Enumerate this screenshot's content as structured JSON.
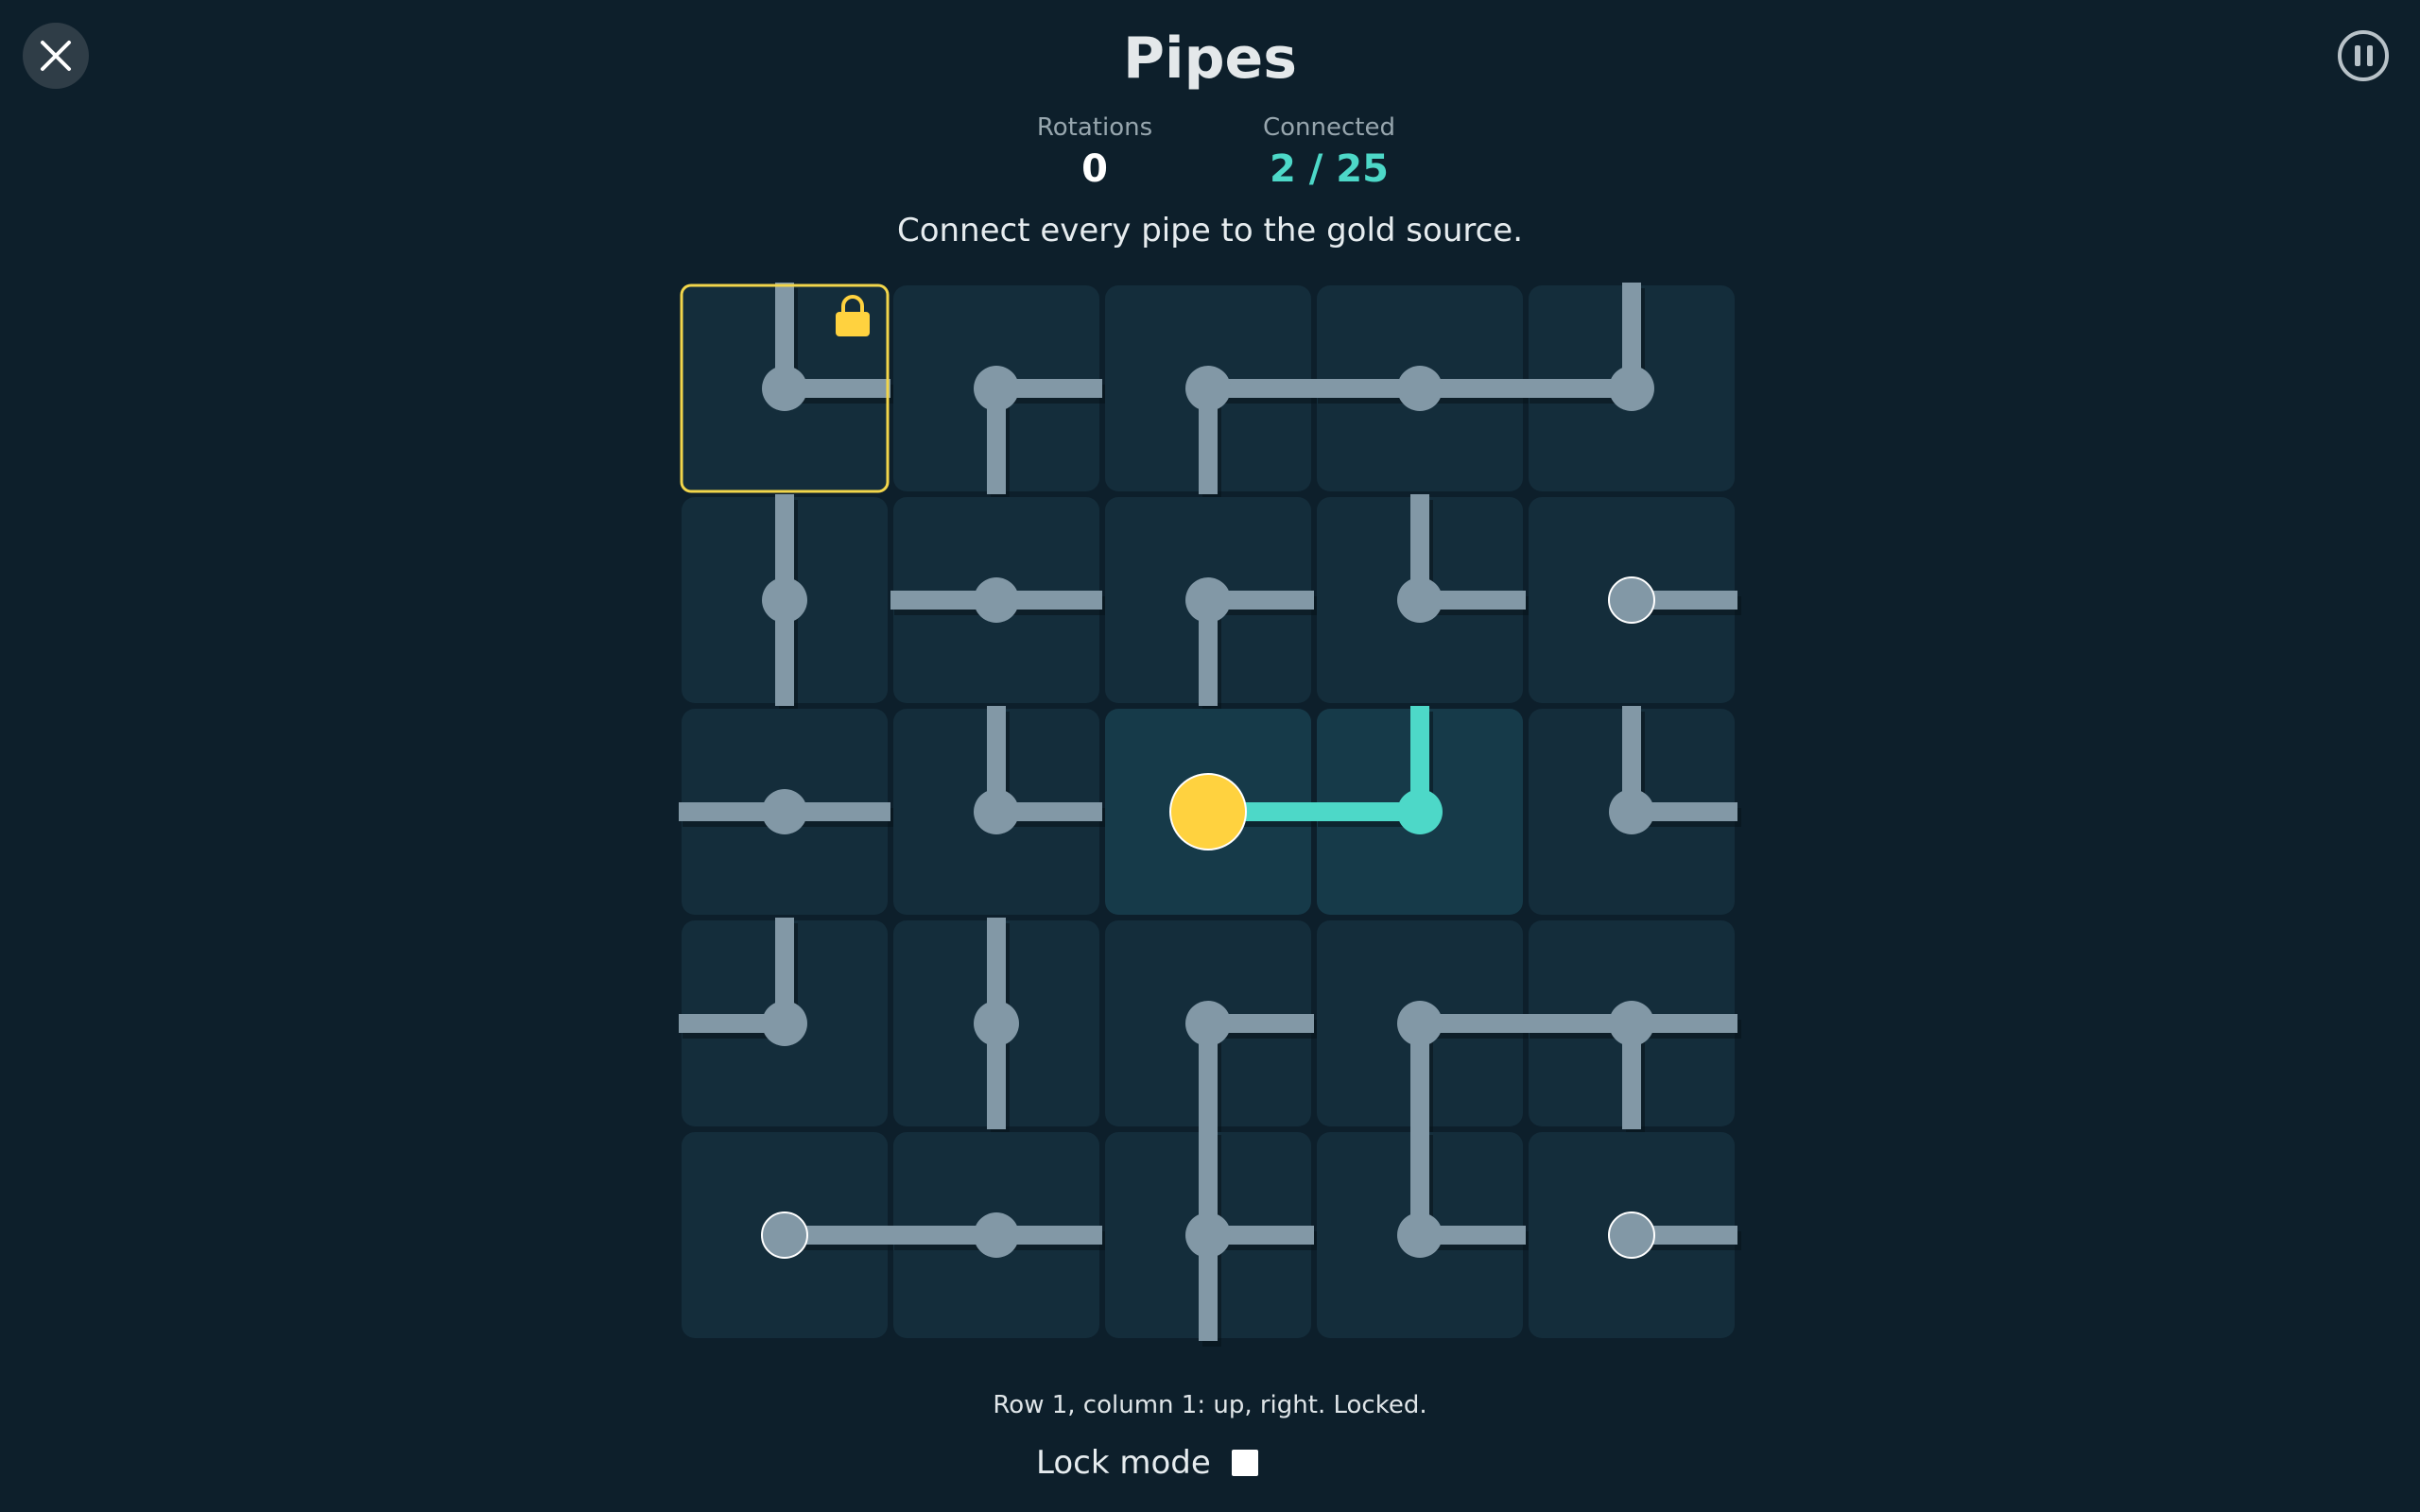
{
  "game": {
    "title": "Pipes",
    "close_icon": "close-icon",
    "pause_icon": "pause-icon"
  },
  "stats": {
    "rotations_label": "Rotations",
    "rotations_value": "0",
    "connected_label": "Connected",
    "connected_value": "2 / 25"
  },
  "instruction": "Connect every pipe to the gold source.",
  "board": {
    "rows": 5,
    "cols": 5,
    "colors": {
      "tile": "#142d3b",
      "tile_connected": "#163a49",
      "pipe": "#8298a6",
      "pipe_connected": "#4dd8c8",
      "source": "#ffd23f",
      "selection": "#f2d64b",
      "lock": "#ffd23f",
      "endpoint_outline": "#ffffff"
    },
    "tiles": [
      [
        {
          "dirs": [
            "up",
            "right"
          ],
          "locked": true,
          "selected": true
        },
        {
          "dirs": [
            "right",
            "down"
          ]
        },
        {
          "dirs": [
            "right",
            "down"
          ]
        },
        {
          "dirs": [
            "left",
            "right"
          ]
        },
        {
          "dirs": [
            "up",
            "left"
          ]
        }
      ],
      [
        {
          "dirs": [
            "up",
            "down"
          ]
        },
        {
          "dirs": [
            "left",
            "right"
          ]
        },
        {
          "dirs": [
            "right",
            "down"
          ]
        },
        {
          "dirs": [
            "up",
            "right"
          ]
        },
        {
          "dirs": [
            "right"
          ],
          "endpoint": true
        }
      ],
      [
        {
          "dirs": [
            "left",
            "right"
          ]
        },
        {
          "dirs": [
            "up",
            "right"
          ]
        },
        {
          "dirs": [
            "right"
          ],
          "source": true,
          "connected": true
        },
        {
          "dirs": [
            "up",
            "left"
          ],
          "connected": true
        },
        {
          "dirs": [
            "up",
            "right"
          ]
        }
      ],
      [
        {
          "dirs": [
            "up",
            "left"
          ]
        },
        {
          "dirs": [
            "up",
            "down"
          ]
        },
        {
          "dirs": [
            "right",
            "down"
          ]
        },
        {
          "dirs": [
            "right",
            "down"
          ]
        },
        {
          "dirs": [
            "left",
            "right",
            "down"
          ]
        }
      ],
      [
        {
          "dirs": [
            "right"
          ],
          "endpoint": true
        },
        {
          "dirs": [
            "left",
            "right"
          ]
        },
        {
          "dirs": [
            "up",
            "right",
            "down"
          ]
        },
        {
          "dirs": [
            "up",
            "right"
          ]
        },
        {
          "dirs": [
            "right"
          ],
          "endpoint": true
        }
      ]
    ]
  },
  "status_text": "Row 1, column 1: up, right. Locked.",
  "lock_mode": {
    "label": "Lock mode",
    "checked": false
  }
}
